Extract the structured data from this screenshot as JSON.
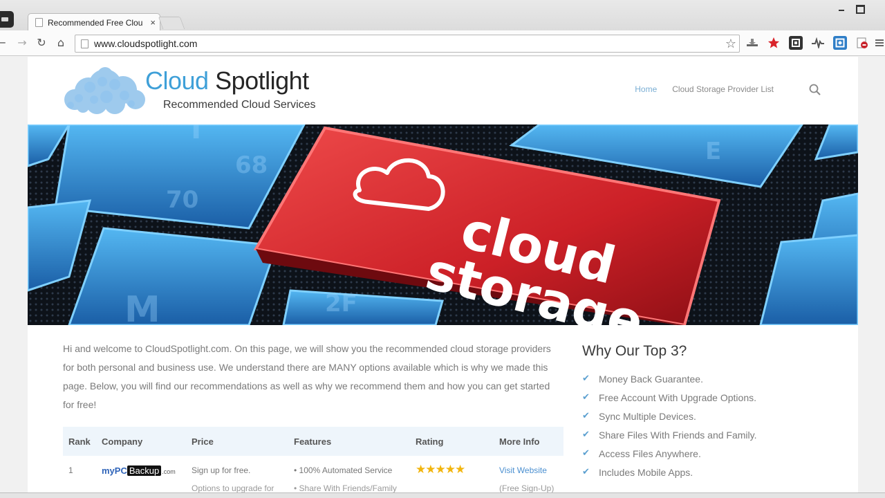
{
  "browser": {
    "tab_title": "Recommended Free Clou",
    "tab_close": "×",
    "url": "www.cloudspotlight.com",
    "nav": {
      "back": "←",
      "forward": "→",
      "reload": "↻",
      "home": "⌂"
    },
    "bookmark_icon": "☆",
    "extensions": [
      "download-icon",
      "lastpass-icon",
      "puzzle-icon",
      "pulse-icon",
      "screen-capture-icon",
      "pdf-icon"
    ]
  },
  "site": {
    "logo_word1": "Cloud",
    "logo_word2": "Spotlight",
    "tagline": "Recommended Cloud Services",
    "nav": [
      {
        "label": "Home",
        "active": true
      },
      {
        "label": "Cloud Storage Provider List",
        "active": false
      }
    ]
  },
  "banner": {
    "line1": "cloud",
    "line2": "storage",
    "key_accent": "#d3282d"
  },
  "intro": "Hi and welcome to CloudSpotlight.com.  On this page, we will show you the recommended cloud storage providers for both personal and business use.  We understand there are MANY options available which is why we made this page.  Below, you will find our recommendations as well as why we recommend them and how you can get started for free!",
  "table": {
    "headers": [
      "Rank",
      "Company",
      "Price",
      "Features",
      "Rating",
      "More Info"
    ],
    "rows": [
      {
        "rank": "1",
        "company_logo": {
          "part1": "myPC",
          "part2": "Backup",
          "part3": ".com"
        },
        "price": "Sign up for free.",
        "price_more": "Options to upgrade for",
        "features": "• 100% Automated Service",
        "features_more": "• Share With Friends/Family",
        "rating_stars": "★★★★★",
        "more_info": "Visit Website",
        "more_info_sub": "(Free Sign-Up)"
      }
    ]
  },
  "sidebar": {
    "title": "Why Our Top 3?",
    "check": "✔",
    "items": [
      "Money Back Guarantee.",
      "Free Account With Upgrade Options.",
      "Sync Multiple Devices.",
      "Share Files With Friends and Family.",
      "Access Files Anywhere.",
      "Includes Mobile Apps."
    ]
  }
}
